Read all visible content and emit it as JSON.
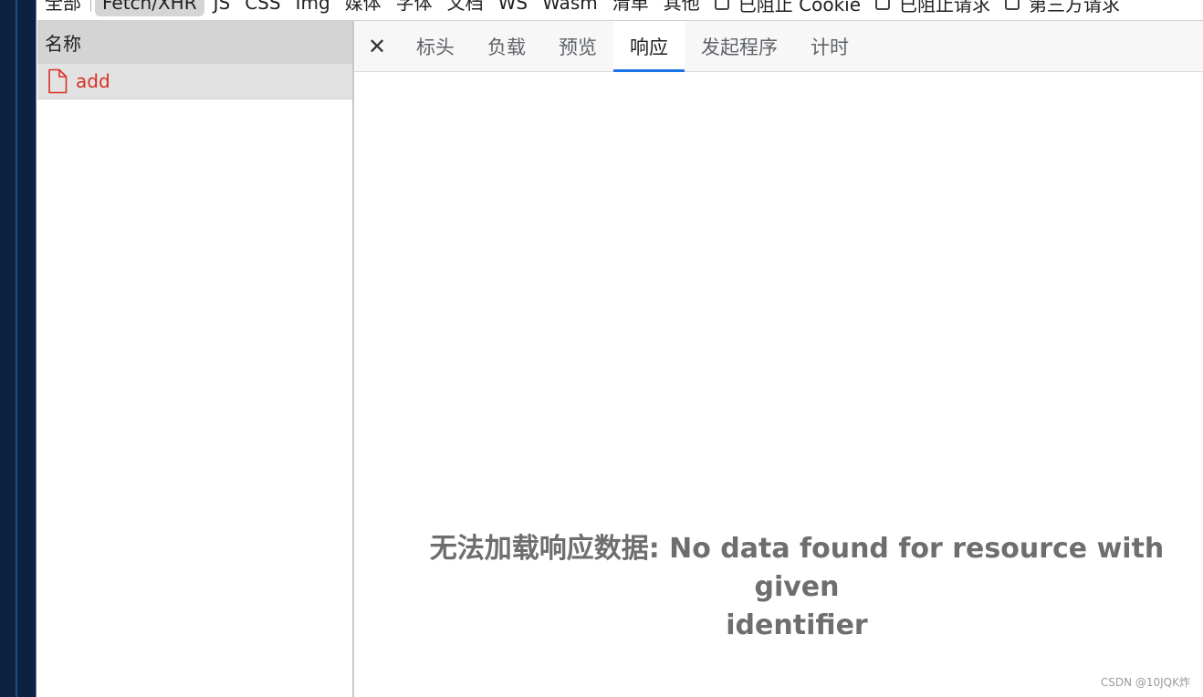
{
  "filters": {
    "items": [
      "全部",
      "Fetch/XHR",
      "JS",
      "CSS",
      "Img",
      "媒体",
      "字体",
      "文档",
      "WS",
      "Wasm",
      "清单",
      "其他"
    ],
    "active_index": 1,
    "checks": [
      "已阻止 Cookie",
      "已阻止请求",
      "第三方请求"
    ]
  },
  "list": {
    "header": "名称",
    "rows": [
      {
        "name": "add",
        "icon": "file-icon"
      }
    ]
  },
  "details": {
    "close_symbol": "✕",
    "tabs": [
      "标头",
      "负载",
      "预览",
      "响应",
      "发起程序",
      "计时"
    ],
    "active_tab": "响应",
    "message_line1": "无法加载响应数据: No data found for resource with given",
    "message_line2": "identifier"
  },
  "watermark": "CSDN @10JQK炸",
  "colors": {
    "accent": "#1a73e8",
    "error_red": "#d93025"
  }
}
